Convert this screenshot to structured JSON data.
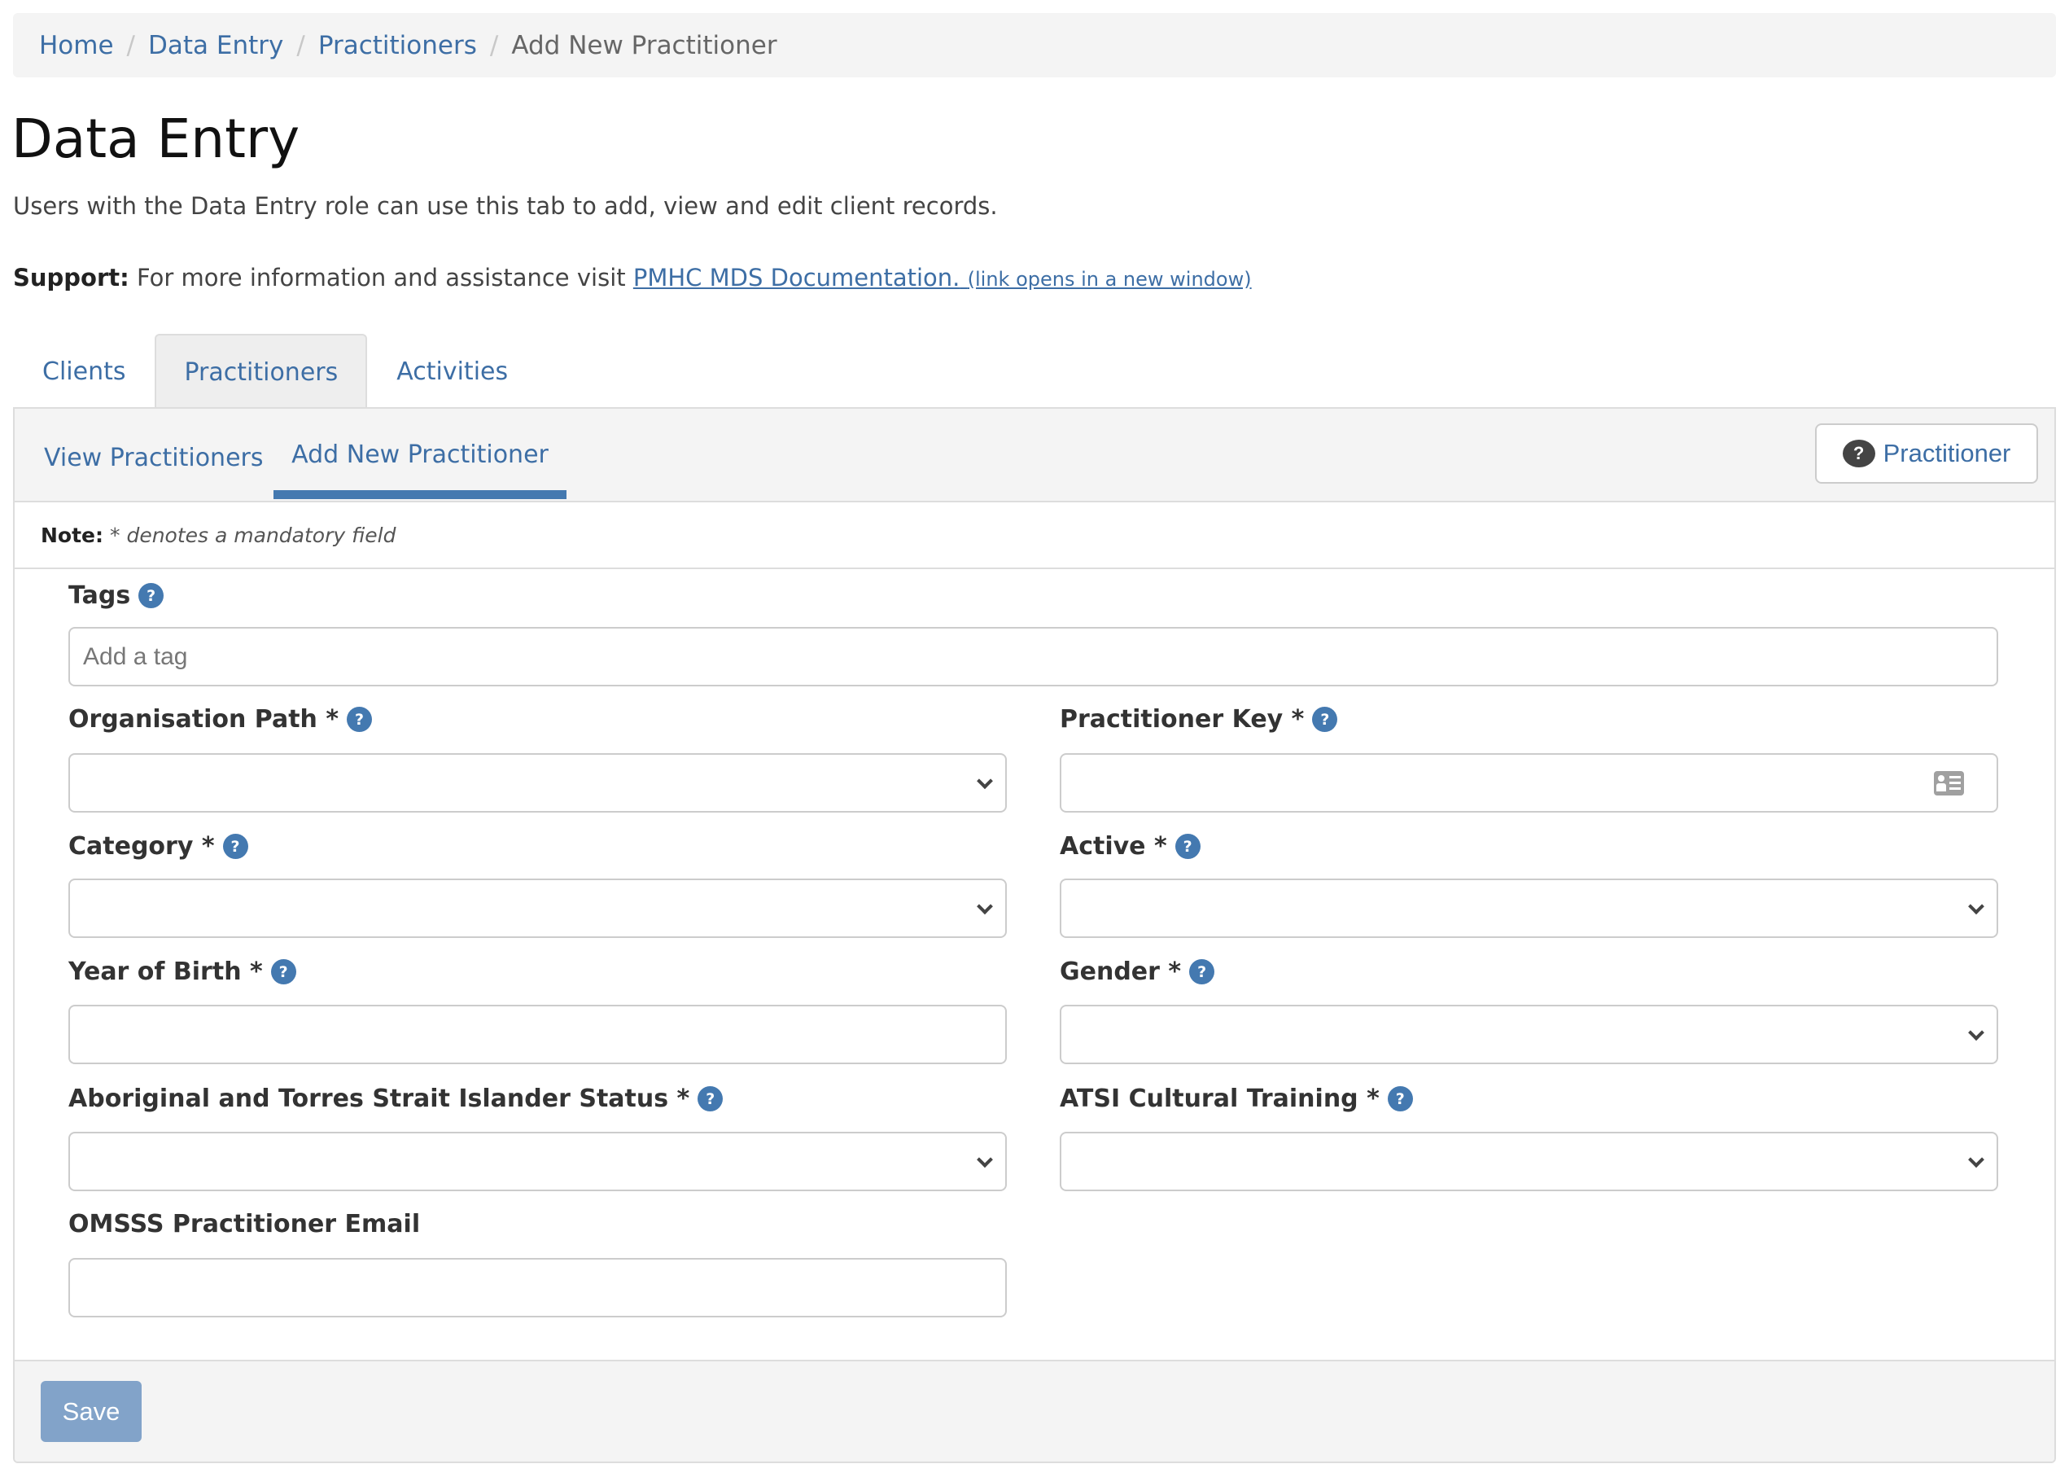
{
  "breadcrumb": {
    "items": [
      "Home",
      "Data Entry",
      "Practitioners"
    ],
    "separator": "/",
    "current": "Add New Practitioner"
  },
  "page": {
    "title": "Data Entry",
    "description": "Users with the Data Entry role can use this tab to add, view and edit client records.",
    "support_label": "Support:",
    "support_text": "For more information and assistance visit",
    "support_link": "PMHC MDS Documentation.",
    "support_link_note": "(link opens in a new window)"
  },
  "tabs": [
    {
      "label": "Clients",
      "active": false
    },
    {
      "label": "Practitioners",
      "active": true
    },
    {
      "label": "Activities",
      "active": false
    }
  ],
  "subtabs": {
    "view": "View Practitioners",
    "add": "Add New Practitioner",
    "help_icon": "?",
    "help_button": "Practitioner"
  },
  "note": {
    "label": "Note:",
    "text": "* denotes a mandatory field"
  },
  "help_icon_glyph": "?",
  "form": {
    "tags": {
      "label": "Tags",
      "placeholder": "Add a tag",
      "value": ""
    },
    "organisation_path": {
      "label": "Organisation Path *",
      "value": ""
    },
    "practitioner_key": {
      "label": "Practitioner Key *",
      "value": "",
      "icon": "id-card-icon"
    },
    "category": {
      "label": "Category *",
      "value": ""
    },
    "active": {
      "label": "Active *",
      "value": ""
    },
    "year_of_birth": {
      "label": "Year of Birth *",
      "value": ""
    },
    "gender": {
      "label": "Gender *",
      "value": ""
    },
    "atsi_status": {
      "label": "Aboriginal and Torres Strait Islander Status *",
      "value": ""
    },
    "atsi_training": {
      "label": "ATSI Cultural Training *",
      "value": ""
    },
    "omsss_email": {
      "label": "OMSSS Practitioner Email",
      "value": ""
    }
  },
  "footer": {
    "save_label": "Save"
  },
  "colors": {
    "link": "#3d6ea5",
    "accent": "#4479b0",
    "save_disabled": "#82a3c9"
  }
}
